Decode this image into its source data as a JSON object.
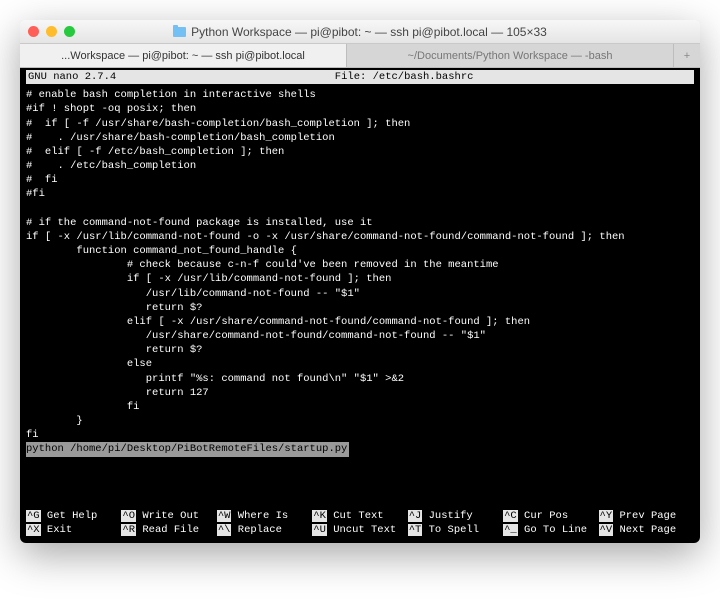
{
  "window": {
    "title": "Python Workspace — pi@pibot: ~ — ssh pi@pibot.local — 105×33"
  },
  "tabs": {
    "active": "...Workspace — pi@pibot: ~ — ssh pi@pibot.local",
    "inactive": "~/Documents/Python Workspace — -bash",
    "newtab": "+"
  },
  "nano": {
    "app": "GNU nano 2.7.4",
    "file_label": "File: /etc/bash.bashrc"
  },
  "code": {
    "l1": "# enable bash completion in interactive shells",
    "l2": "#if ! shopt -oq posix; then",
    "l3": "#  if [ -f /usr/share/bash-completion/bash_completion ]; then",
    "l4": "#    . /usr/share/bash-completion/bash_completion",
    "l5": "#  elif [ -f /etc/bash_completion ]; then",
    "l6": "#    . /etc/bash_completion",
    "l7": "#  fi",
    "l8": "#fi",
    "l9": "",
    "l10": "# if the command-not-found package is installed, use it",
    "l11": "if [ -x /usr/lib/command-not-found -o -x /usr/share/command-not-found/command-not-found ]; then",
    "l12": "        function command_not_found_handle {",
    "l13": "                # check because c-n-f could've been removed in the meantime",
    "l14": "                if [ -x /usr/lib/command-not-found ]; then",
    "l15": "                   /usr/lib/command-not-found -- \"$1\"",
    "l16": "                   return $?",
    "l17": "                elif [ -x /usr/share/command-not-found/command-not-found ]; then",
    "l18": "                   /usr/share/command-not-found/command-not-found -- \"$1\"",
    "l19": "                   return $?",
    "l20": "                else",
    "l21": "                   printf \"%s: command not found\\n\" \"$1\" >&2",
    "l22": "                   return 127",
    "l23": "                fi",
    "l24": "        }",
    "l25": "fi",
    "cursor": "python /home/pi/Desktop/PiBotRemoteFiles/startup.py"
  },
  "shortcuts": {
    "row1": [
      {
        "key": "^G",
        "label": "Get Help"
      },
      {
        "key": "^O",
        "label": "Write Out"
      },
      {
        "key": "^W",
        "label": "Where Is"
      },
      {
        "key": "^K",
        "label": "Cut Text"
      },
      {
        "key": "^J",
        "label": "Justify"
      },
      {
        "key": "^C",
        "label": "Cur Pos"
      },
      {
        "key": "^Y",
        "label": "Prev Page"
      }
    ],
    "row2": [
      {
        "key": "^X",
        "label": "Exit"
      },
      {
        "key": "^R",
        "label": "Read File"
      },
      {
        "key": "^\\",
        "label": "Replace"
      },
      {
        "key": "^U",
        "label": "Uncut Text"
      },
      {
        "key": "^T",
        "label": "To Spell"
      },
      {
        "key": "^_",
        "label": "Go To Line"
      },
      {
        "key": "^V",
        "label": "Next Page"
      }
    ]
  }
}
